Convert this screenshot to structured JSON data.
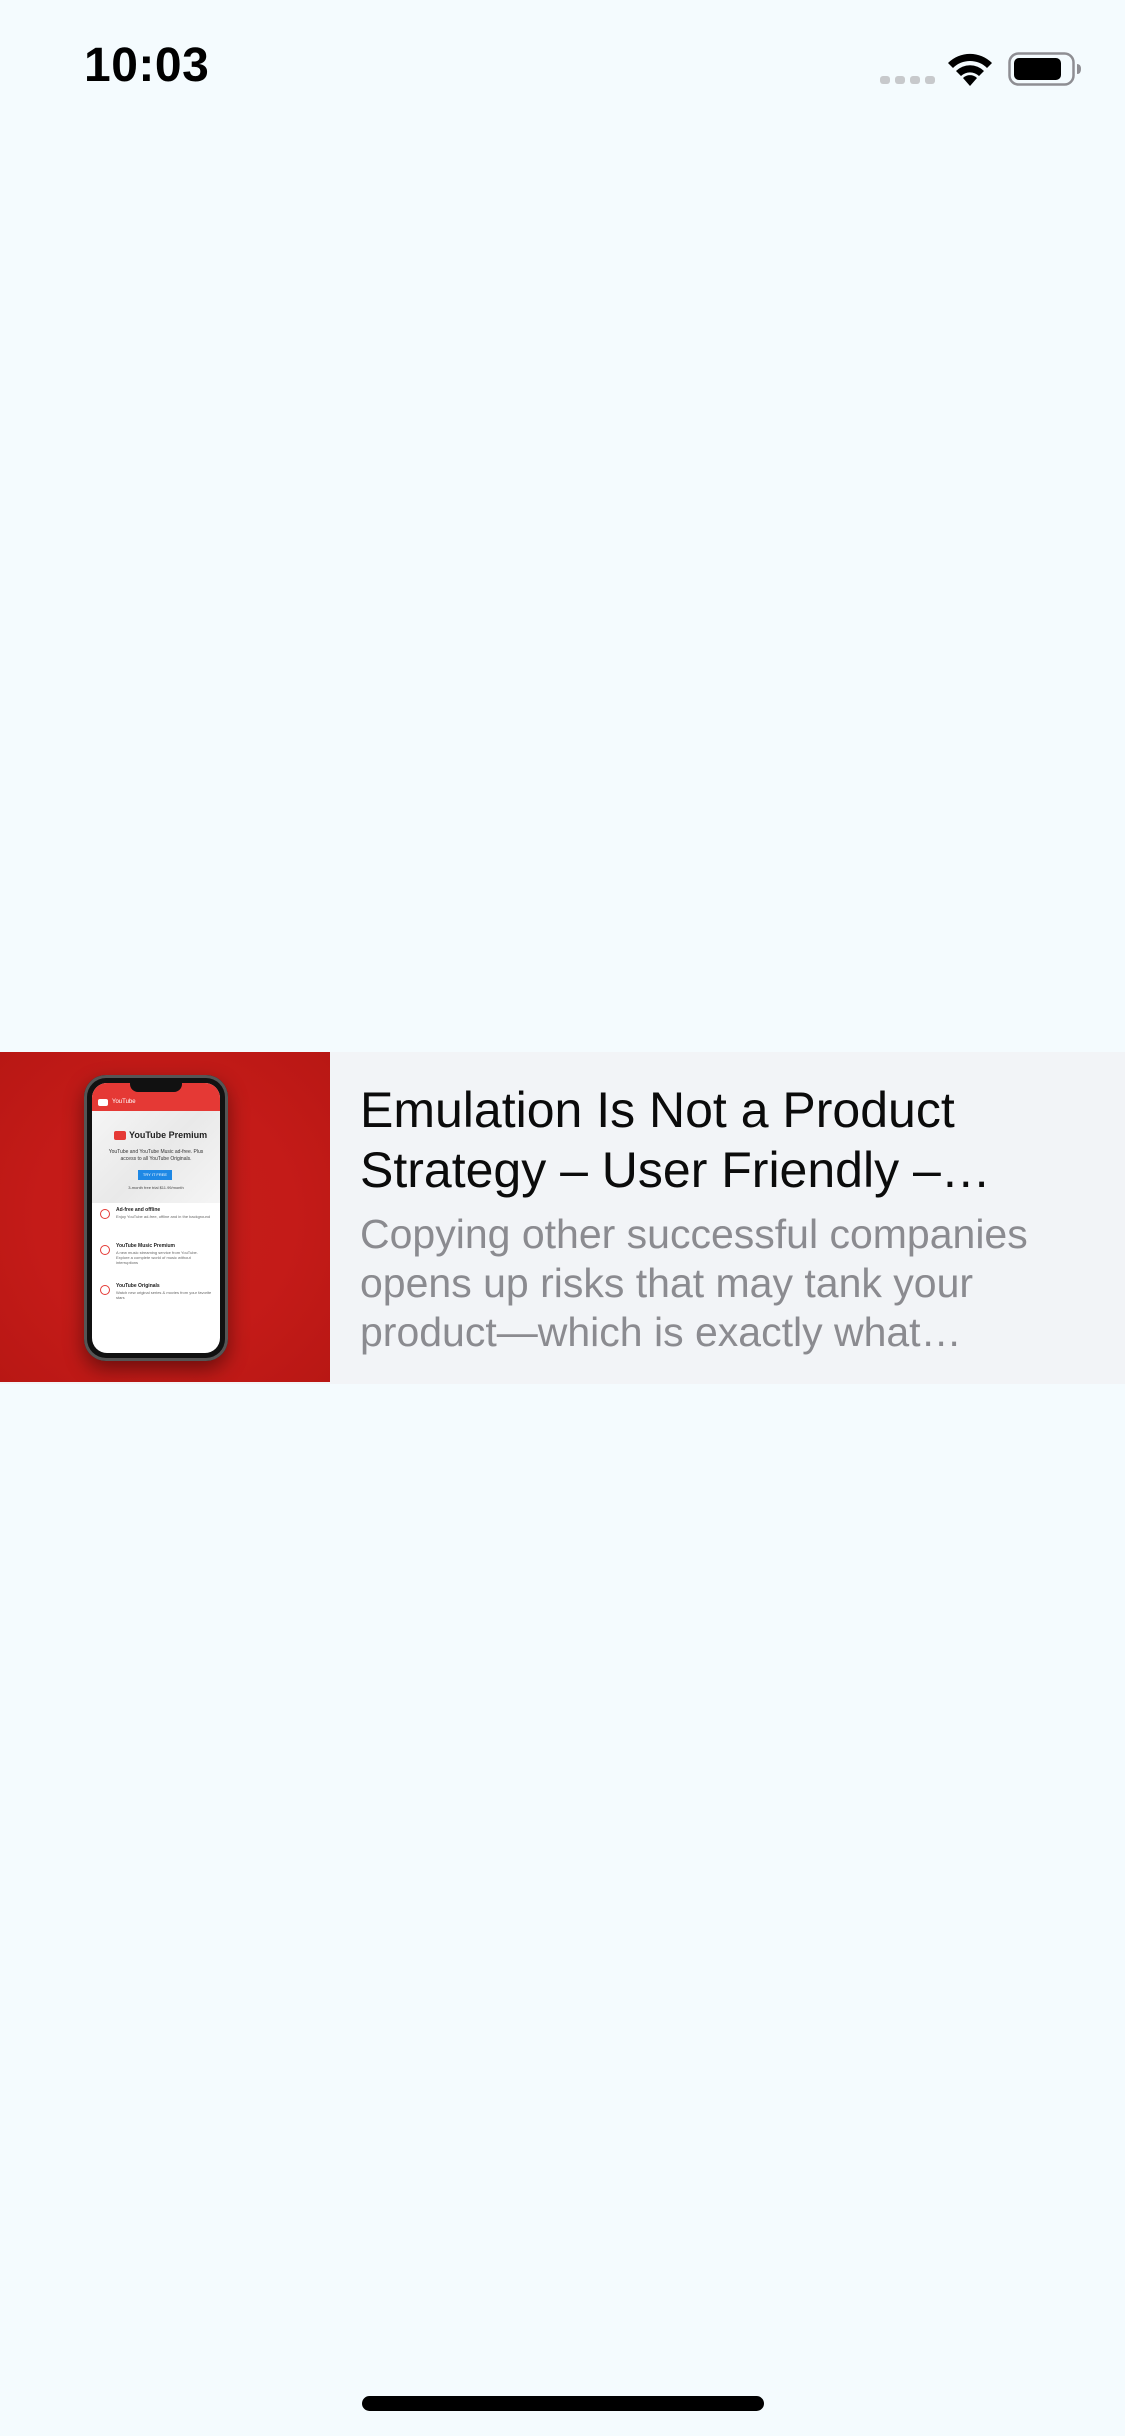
{
  "status_bar": {
    "time": "10:03",
    "signal_icon": "cellular-signal-icon",
    "wifi_icon": "wifi-icon",
    "battery_icon": "battery-icon"
  },
  "link_preview": {
    "title": "Emulation Is Not a Product Strategy – User Friendly – Medium",
    "description": "Copying other successful companies opens up risks that may tank your product—which is exactly what happened",
    "thumbnail": {
      "app_bar_label": "YouTube",
      "brand": "YouTube Premium",
      "subtitle": "YouTube and YouTube Music ad-free. Plus access to all YouTube Originals.",
      "button_label": "TRY IT FREE",
      "price": "3-month free trial $11.99/month",
      "features": [
        {
          "title": "Ad-free and offline",
          "desc": "Enjoy YouTube ad-free, offline and in the background"
        },
        {
          "title": "YouTube Music Premium",
          "desc": "A new music streaming service from YouTube. Explore a complete world of music without interruptions"
        },
        {
          "title": "YouTube Originals",
          "desc": "Watch new original series & movies from your favorite stars"
        }
      ]
    }
  },
  "colors": {
    "background": "#f4fbfe",
    "card_background": "#f2f4f7",
    "thumbnail_red": "#c41b18",
    "title_text": "#0b0b0b",
    "description_text": "#8b8b90"
  }
}
